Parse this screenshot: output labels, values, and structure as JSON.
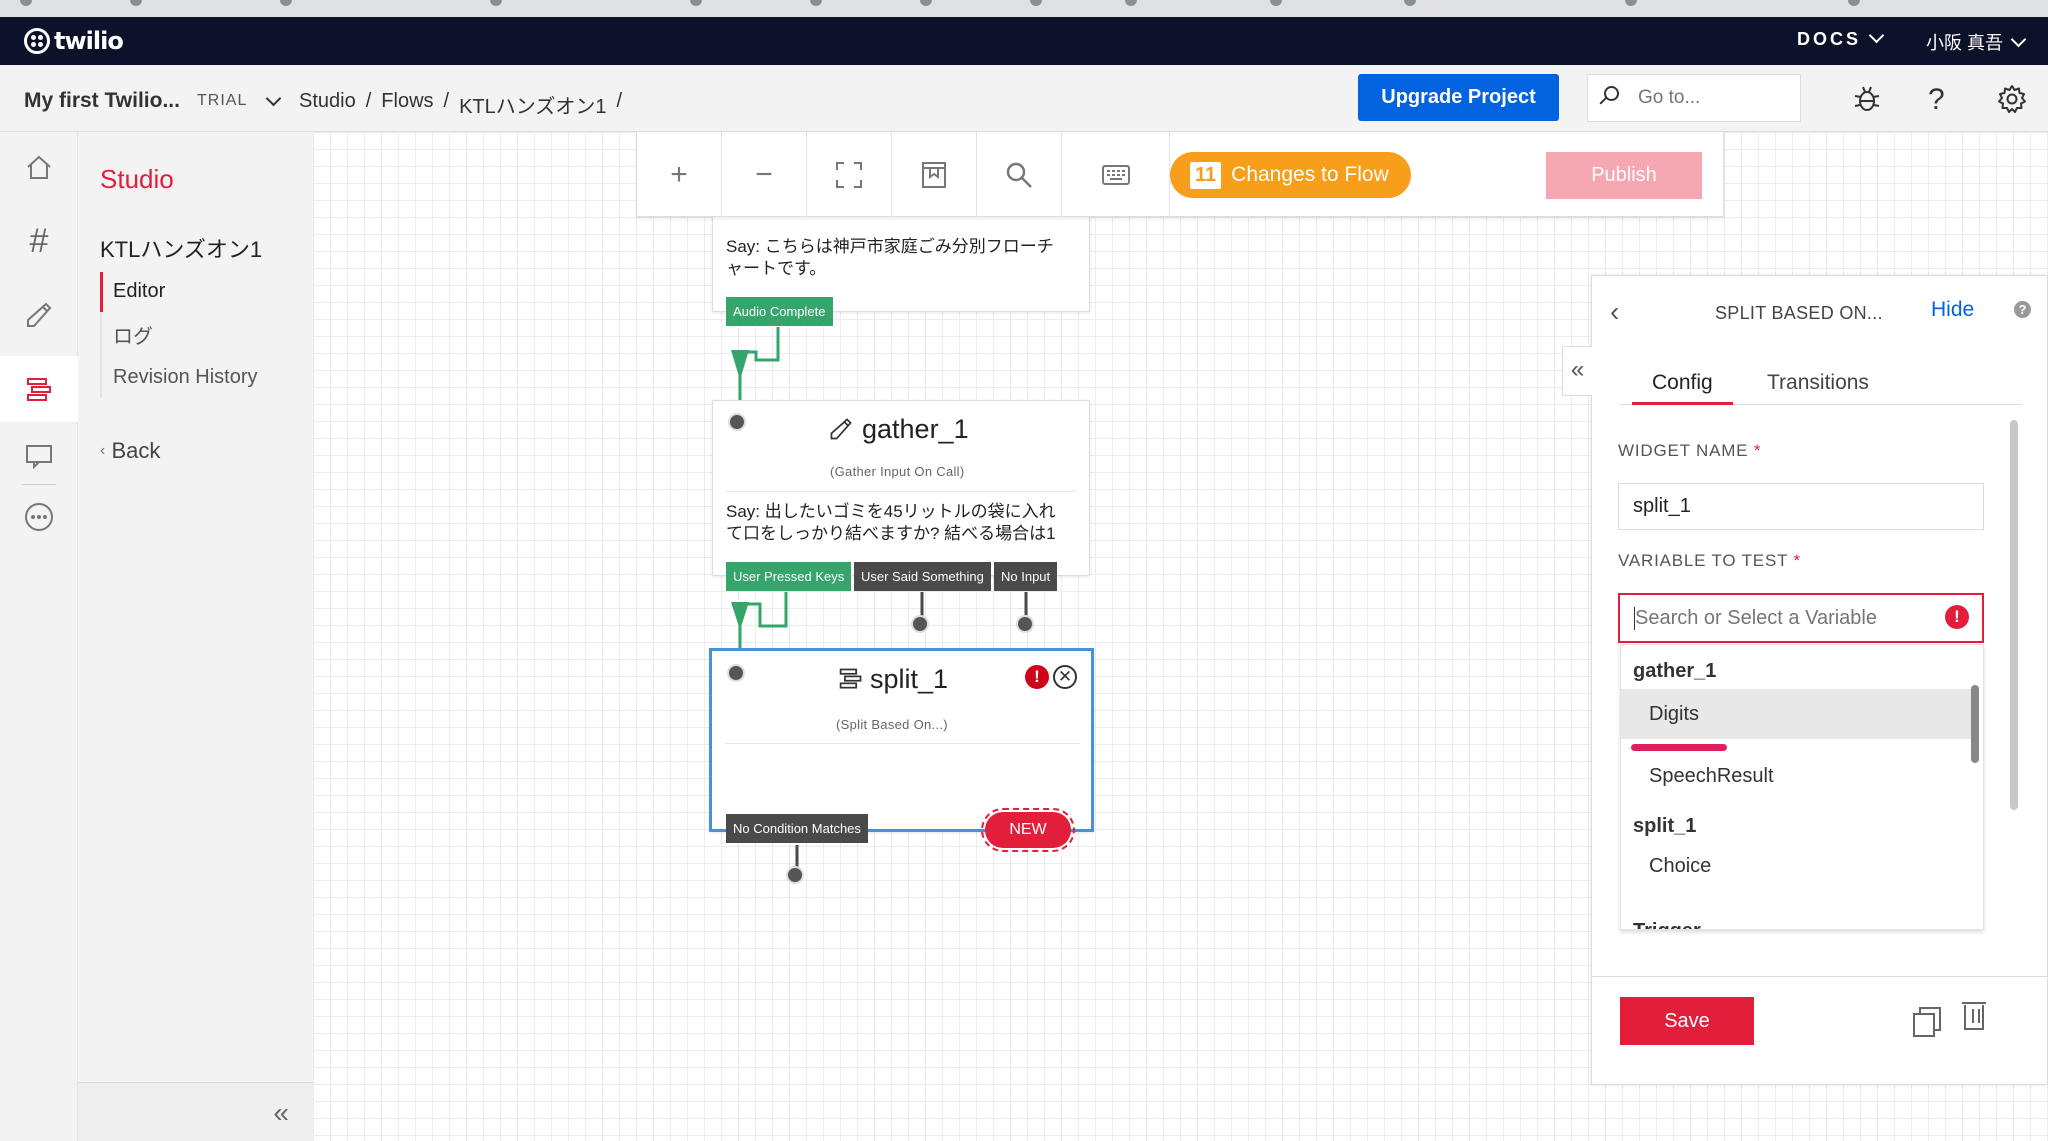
{
  "topbar": {
    "logo_text": "twilio",
    "docs_label": "DOCS",
    "user_label": "小阪 真吾"
  },
  "projectbar": {
    "project_name": "My first Twilio...",
    "badge": "TRIAL",
    "breadcrumb": [
      "Studio",
      "Flows",
      "KTLハンズオン1"
    ],
    "separator": "/",
    "upgrade_label": "Upgrade Project",
    "goto_placeholder": "Go to..."
  },
  "subnav": {
    "title": "Studio",
    "flow_name": "KTLハンズオン1",
    "items": [
      {
        "label": "Editor",
        "active": true
      },
      {
        "label": "ログ",
        "active": false
      },
      {
        "label": "Revision History",
        "active": false
      }
    ],
    "back_label": "Back"
  },
  "toolbar": {
    "changes_count": "11",
    "changes_label": "Changes to Flow",
    "publish_label": "Publish"
  },
  "widgets": {
    "say_widget": {
      "say_line1": "Say: こちらは神戸市家庭ごみ分別フローチ",
      "say_line2": "ャートです。",
      "transition": "Audio Complete"
    },
    "gather": {
      "name": "gather_1",
      "type": "(Gather Input On Call)",
      "say_line1": "Say: 出したいゴミを45リットルの袋に入れ",
      "say_line2": "て口をしっかり結べますか? 結べる場合は1",
      "transitions": [
        "User Pressed Keys",
        "User Said Something",
        "No Input"
      ]
    },
    "split": {
      "name": "split_1",
      "type": "(Split Based On...)",
      "transition": "No Condition Matches",
      "new_label": "NEW"
    }
  },
  "panel": {
    "title": "SPLIT BASED ON...",
    "hide_label": "Hide",
    "tabs": [
      "Config",
      "Transitions"
    ],
    "widget_name_label": "WIDGET NAME",
    "widget_name_value": "split_1",
    "variable_label": "VARIABLE TO TEST",
    "variable_placeholder": "Search or Select a Variable",
    "dropdown": {
      "group1": "gather_1",
      "group1_options": [
        "Digits",
        "SpeechResult"
      ],
      "group2": "split_1",
      "group2_options": [
        "Choice"
      ],
      "group3_partial": "Trigger"
    },
    "save_label": "Save"
  },
  "colors": {
    "brand_red": "#e31e3b",
    "primary_blue": "#0263e0",
    "topbar_navy": "#0d122b",
    "transition_green": "#36a56b",
    "changes_orange": "#f79e1b",
    "selected_widget_blue": "#4a90d9"
  }
}
